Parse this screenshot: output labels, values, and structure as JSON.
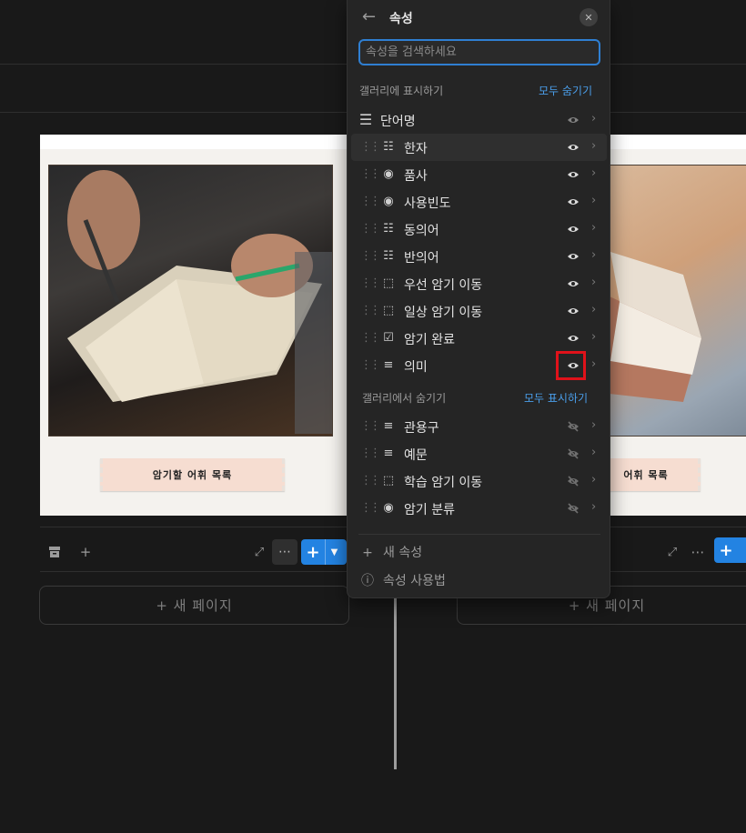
{
  "background": {
    "cards": [
      {
        "tape_label": "암기할 어휘 목록"
      },
      {
        "tape_label": "어휘 목록"
      }
    ],
    "new_page_label": "+ 새 페이지"
  },
  "panel": {
    "title": "속성",
    "search_placeholder": "속성을 검색하세요",
    "shown_section": {
      "label": "갤러리에 표시하기",
      "action": "모두 숨기기"
    },
    "title_property": {
      "label": "단어명",
      "visible": true
    },
    "shown_properties": [
      {
        "label": "한자",
        "icon": "list-icon",
        "visible": true,
        "highlighted_row": true
      },
      {
        "label": "품사",
        "icon": "select-icon",
        "visible": true
      },
      {
        "label": "사용빈도",
        "icon": "select-icon",
        "visible": true
      },
      {
        "label": "동의어",
        "icon": "list-icon",
        "visible": true
      },
      {
        "label": "반의어",
        "icon": "list-icon",
        "visible": true
      },
      {
        "label": "우선 암기 이동",
        "icon": "button-icon",
        "visible": true
      },
      {
        "label": "일상 암기 이동",
        "icon": "button-icon",
        "visible": true
      },
      {
        "label": "암기 완료",
        "icon": "checkbox-icon",
        "visible": true
      },
      {
        "label": "의미",
        "icon": "text-icon",
        "visible": true,
        "annotated": true
      }
    ],
    "hidden_section": {
      "label": "갤러리에서 숨기기",
      "action": "모두 표시하기"
    },
    "hidden_properties": [
      {
        "label": "관용구",
        "icon": "text-icon",
        "visible": false
      },
      {
        "label": "예문",
        "icon": "text-icon",
        "visible": false
      },
      {
        "label": "학습 암기 이동",
        "icon": "button-icon",
        "visible": false
      },
      {
        "label": "암기 분류",
        "icon": "select-icon",
        "visible": false
      }
    ],
    "footer": {
      "new_property": "새 속성",
      "help": "속성 사용법"
    }
  },
  "colors": {
    "accent": "#2383e2",
    "link": "#4a9eea",
    "annotation": "#e0121a"
  }
}
